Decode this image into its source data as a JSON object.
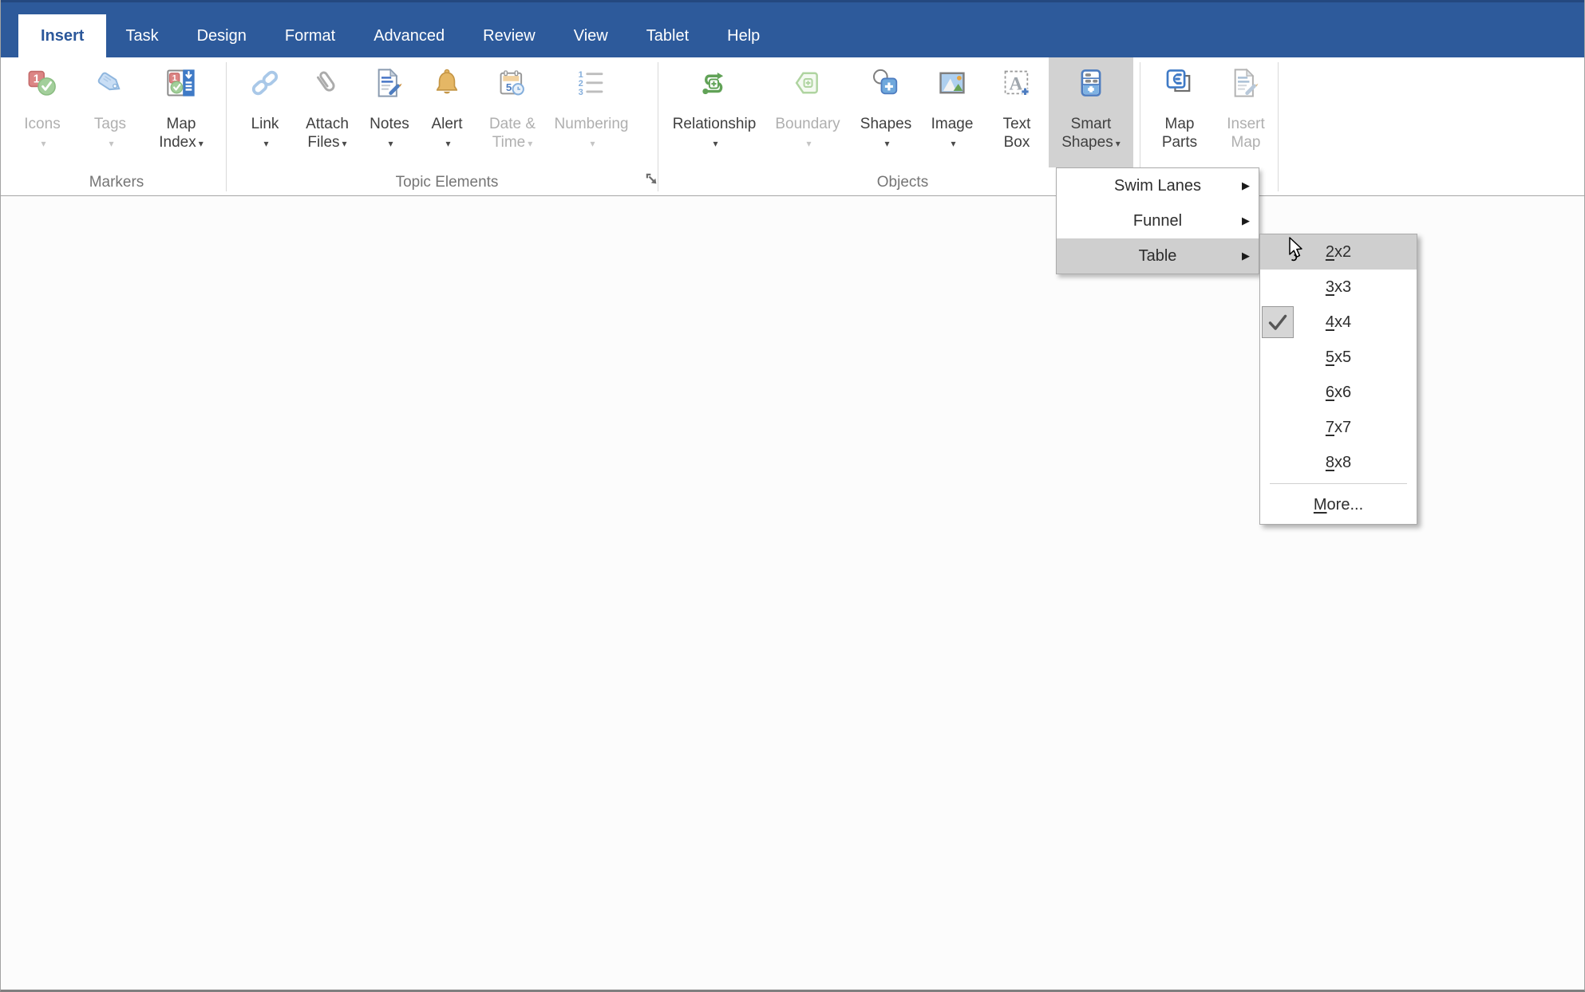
{
  "menubar": {
    "tabs": [
      {
        "label": "Insert",
        "active": true
      },
      {
        "label": "Task"
      },
      {
        "label": "Design"
      },
      {
        "label": "Format"
      },
      {
        "label": "Advanced"
      },
      {
        "label": "Review"
      },
      {
        "label": "View"
      },
      {
        "label": "Tablet"
      },
      {
        "label": "Help"
      }
    ]
  },
  "ribbon": {
    "groups": [
      {
        "name": "Markers",
        "buttons": [
          {
            "line1": "Icons",
            "line2": "",
            "caret": true,
            "disabled": true,
            "icon": "icons-icon"
          },
          {
            "line1": "Tags",
            "line2": "",
            "caret": true,
            "disabled": true,
            "icon": "tag-icon"
          },
          {
            "line1": "Map",
            "line2": "Index",
            "caret": true,
            "disabled": false,
            "icon": "map-index-icon"
          }
        ]
      },
      {
        "name": "Topic Elements",
        "has_dialog_launcher": true,
        "buttons": [
          {
            "line1": "Link",
            "line2": "",
            "caret": true,
            "disabled": false,
            "icon": "link-icon"
          },
          {
            "line1": "Attach",
            "line2": "Files",
            "caret": true,
            "disabled": false,
            "icon": "paperclip-icon"
          },
          {
            "line1": "Notes",
            "line2": "",
            "caret": true,
            "disabled": false,
            "icon": "notes-icon"
          },
          {
            "line1": "Alert",
            "line2": "",
            "caret": true,
            "disabled": false,
            "icon": "bell-icon"
          },
          {
            "line1": "Date &",
            "line2": "Time",
            "caret": true,
            "disabled": true,
            "icon": "calendar-clock-icon"
          },
          {
            "line1": "Numbering",
            "line2": "",
            "caret": true,
            "disabled": true,
            "icon": "numbered-list-icon"
          }
        ]
      },
      {
        "name": "Objects",
        "buttons": [
          {
            "line1": "Relationship",
            "line2": "",
            "caret": true,
            "disabled": false,
            "icon": "relationship-icon"
          },
          {
            "line1": "Boundary",
            "line2": "",
            "caret": true,
            "disabled": true,
            "icon": "boundary-icon"
          },
          {
            "line1": "Shapes",
            "line2": "",
            "caret": true,
            "disabled": false,
            "icon": "shapes-icon"
          },
          {
            "line1": "Image",
            "line2": "",
            "caret": true,
            "disabled": false,
            "icon": "image-icon"
          },
          {
            "line1": "Text",
            "line2": "Box",
            "caret": false,
            "disabled": false,
            "icon": "text-box-icon"
          },
          {
            "line1": "Smart",
            "line2": "Shapes",
            "caret": true,
            "disabled": false,
            "pressed": true,
            "icon": "smart-shapes-icon"
          }
        ]
      },
      {
        "name": "",
        "buttons": [
          {
            "line1": "Map",
            "line2": "Parts",
            "caret": false,
            "disabled": false,
            "icon": "map-parts-icon"
          },
          {
            "line1": "Insert",
            "line2": "Map",
            "caret": false,
            "disabled": true,
            "icon": "insert-map-icon"
          }
        ]
      }
    ]
  },
  "smart_shapes_menu": {
    "items": [
      {
        "label": "Swim Lanes",
        "has_submenu": true,
        "highlighted": false
      },
      {
        "label": "Funnel",
        "has_submenu": true,
        "highlighted": false
      },
      {
        "label": "Table",
        "has_submenu": true,
        "highlighted": true
      }
    ]
  },
  "table_submenu": {
    "items": [
      {
        "key": "2",
        "rest": "x2",
        "highlighted": true
      },
      {
        "key": "3",
        "rest": "x3"
      },
      {
        "key": "4",
        "rest": "x4",
        "checked": true
      },
      {
        "key": "5",
        "rest": "x5"
      },
      {
        "key": "6",
        "rest": "x6"
      },
      {
        "key": "7",
        "rest": "x7"
      },
      {
        "key": "8",
        "rest": "x8"
      },
      {
        "key": "M",
        "rest": "ore...",
        "separator_before": true
      }
    ]
  },
  "colors": {
    "menubar_blue": "#2D5A9B",
    "active_tab_text": "#2B579A",
    "pressed_button_bg": "#D2D2D2",
    "menu_highlight": "#CFCFCF",
    "enabled_label": "#404040",
    "disabled_label": "#AFAFAF",
    "group_label": "#757575"
  }
}
